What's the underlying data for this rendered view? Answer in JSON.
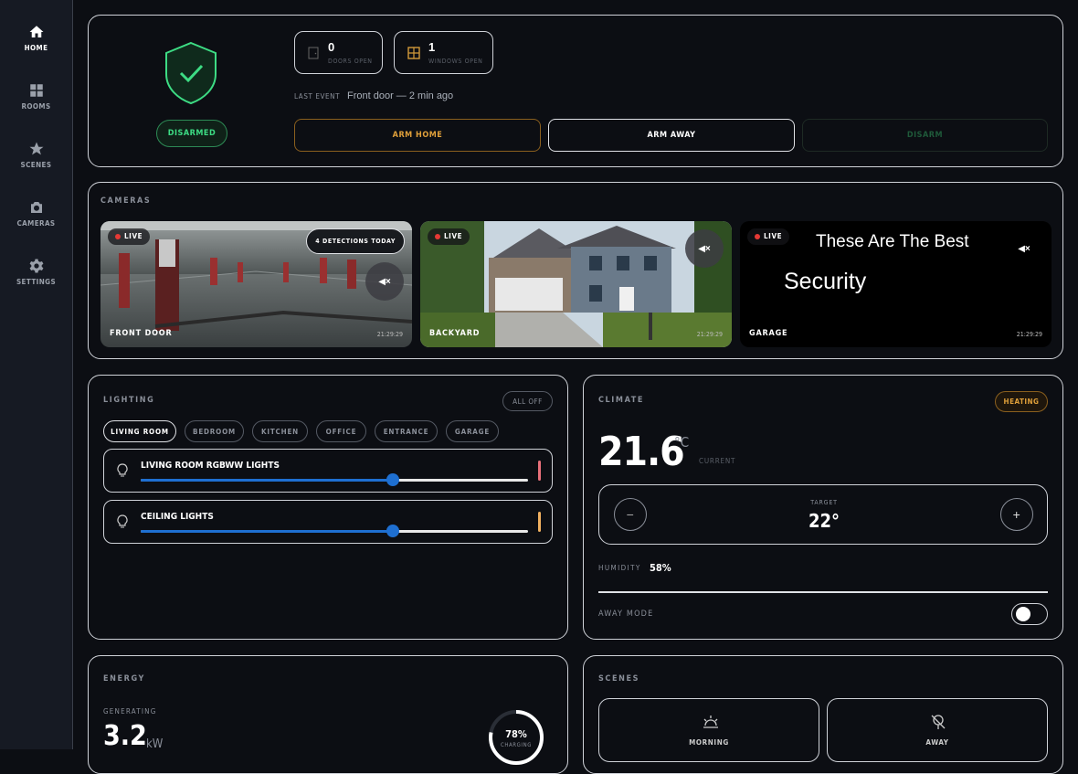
{
  "nav": [
    {
      "label": "HOME",
      "icon": "home-icon"
    },
    {
      "label": "ROOMS",
      "icon": "grid-icon"
    },
    {
      "label": "SCENES",
      "icon": "star-icon"
    },
    {
      "label": "CAMERAS",
      "icon": "camera-icon"
    },
    {
      "label": "SETTINGS",
      "icon": "gear-icon"
    }
  ],
  "security": {
    "status": "DISARMED",
    "doors": {
      "count": "0",
      "label": "DOORS OPEN"
    },
    "windows": {
      "count": "1",
      "label": "WINDOWS OPEN"
    },
    "last_event_label": "LAST EVENT",
    "last_event": "Front door — 2 min ago",
    "arm_home": "ARM HOME",
    "arm_away": "ARM AWAY",
    "disarm": "DISARM"
  },
  "cameras": {
    "title": "CAMERAS",
    "items": [
      {
        "name": "FRONT DOOR",
        "live": "LIVE",
        "time": "21:29:29",
        "detections": "4 DETECTIONS TODAY",
        "mute": "◀×"
      },
      {
        "name": "BACKYARD",
        "live": "LIVE",
        "time": "21:29:29",
        "mute": "◀×"
      },
      {
        "name": "GARAGE",
        "live": "LIVE",
        "time": "21:29:29",
        "mute": "◀×",
        "overlay_line1": "These Are The Best",
        "overlay_line2": "Security"
      }
    ]
  },
  "lighting": {
    "title": "LIGHTING",
    "all_off": "ALL OFF",
    "rooms": [
      "LIVING ROOM",
      "BEDROOM",
      "KITCHEN",
      "OFFICE",
      "ENTRANCE",
      "GARAGE"
    ],
    "lights": [
      {
        "name": "LIVING ROOM RGBWW LIGHTS",
        "brightness": 0.65,
        "color": "#e8707a"
      },
      {
        "name": "CEILING LIGHTS",
        "brightness": 0.65,
        "color": "#f0b060"
      }
    ]
  },
  "climate": {
    "title": "CLIMATE",
    "mode": "HEATING",
    "current": "21.6",
    "unit": "°C",
    "current_label": "CURRENT",
    "target_label": "TARGET",
    "target": "22°",
    "humidity_label": "HUMIDITY",
    "humidity": "58%",
    "away_label": "AWAY MODE",
    "away_on": false
  },
  "energy": {
    "title": "ENERGY",
    "generating_label": "GENERATING",
    "value": "3.2",
    "unit": "kW",
    "battery": "78%",
    "battery_level": 0.78,
    "battery_label": "CHARGING"
  },
  "scenes": {
    "title": "SCENES",
    "items": [
      {
        "label": "MORNING",
        "icon": "sunrise-icon"
      },
      {
        "label": "AWAY",
        "icon": "away-icon"
      }
    ]
  },
  "colors": {
    "accent_green": "#3ddc84",
    "accent_orange": "#d39a3a",
    "blue": "#1e6fd1"
  }
}
